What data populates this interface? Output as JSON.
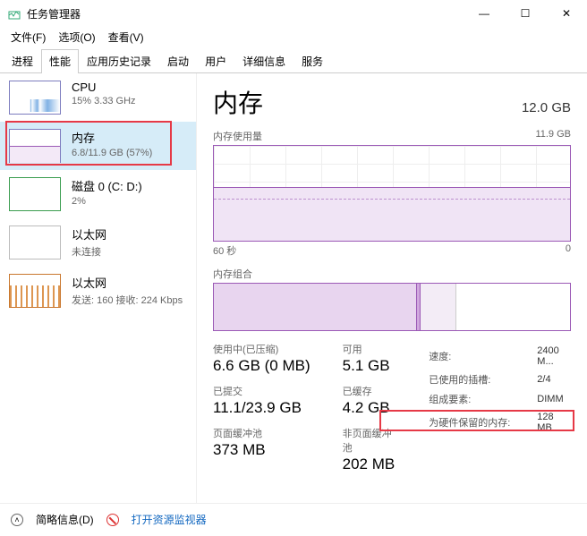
{
  "window": {
    "title": "任务管理器",
    "min": "—",
    "max": "☐",
    "close": "✕"
  },
  "menu": {
    "file": "文件(F)",
    "options": "选项(O)",
    "view": "查看(V)"
  },
  "tabs": [
    "进程",
    "性能",
    "应用历史记录",
    "启动",
    "用户",
    "详细信息",
    "服务"
  ],
  "activeTabIndex": 1,
  "sidebar": [
    {
      "name": "CPU",
      "sub": "15% 3.33 GHz",
      "thumbClass": "cpu"
    },
    {
      "name": "内存",
      "sub": "6.8/11.9 GB (57%)",
      "thumbClass": "mem",
      "selected": true
    },
    {
      "name": "磁盘 0 (C: D:)",
      "sub": "2%",
      "thumbClass": "disk"
    },
    {
      "name": "以太网",
      "sub": "未连接",
      "thumbClass": "eth"
    },
    {
      "name": "以太网",
      "sub": "发送: 160 接收: 224 Kbps",
      "thumbClass": "eth2"
    }
  ],
  "main": {
    "title": "内存",
    "total": "12.0 GB",
    "usageLabel": "内存使用量",
    "usageMax": "11.9 GB",
    "xleft": "60 秒",
    "xright": "0",
    "compoLabel": "内存组合"
  },
  "stats": {
    "inUse": {
      "label": "使用中(已压缩)",
      "value": "6.6 GB (0 MB)"
    },
    "avail": {
      "label": "可用",
      "value": "5.1 GB"
    },
    "committed": {
      "label": "已提交",
      "value": "11.1/23.9 GB"
    },
    "cached": {
      "label": "已缓存",
      "value": "4.2 GB"
    },
    "pagedPool": {
      "label": "页面缓冲池",
      "value": "373 MB"
    },
    "nonPaged": {
      "label": "非页面缓冲池",
      "value": "202 MB"
    }
  },
  "details": {
    "speed": {
      "label": "速度:",
      "value": "2400 M..."
    },
    "slots": {
      "label": "已使用的插槽:",
      "value": "2/4"
    },
    "form": {
      "label": "组成要素:",
      "value": "DIMM"
    },
    "reserved": {
      "label": "为硬件保留的内存:",
      "value": "128 MB"
    }
  },
  "footer": {
    "fewer": "简略信息(D)",
    "resmon": "打开资源监视器"
  },
  "chart_data": {
    "type": "area",
    "title": "内存使用量",
    "ylabel": "GB",
    "ylim": [
      0,
      11.9
    ],
    "xrange_seconds": 60,
    "series": [
      {
        "name": "使用中",
        "approx_constant_value": 6.8
      }
    ]
  }
}
